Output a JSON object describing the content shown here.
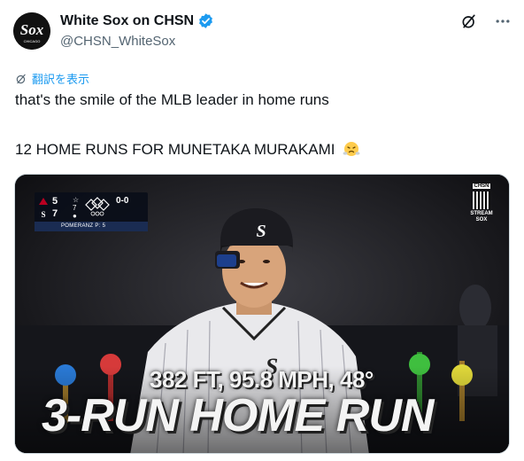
{
  "account": {
    "display_name": "White Sox on CHSN",
    "handle": "@CHSN_WhiteSox"
  },
  "icons": {
    "avatar": "white-sox-logo",
    "verified": "verified-badge-icon",
    "grok": "grok-icon",
    "more": "more-icon",
    "translate": "translate-icon",
    "emoji": "face-with-steam-emoji"
  },
  "translate_label": "翻訳を表示",
  "tweet": {
    "line1": "that's the smile of the MLB leader in home runs",
    "line2": "12 HOME RUNS FOR MUNETAKA MURAKAMI"
  },
  "video": {
    "scorebug": {
      "team1_score": "5",
      "team2_score": "7",
      "inning": "7",
      "count": "0-0",
      "pitcher": "POMERANZ  P: 5"
    },
    "network_tag": "CHSN",
    "network_label": "STREAM SOX",
    "stat_line": "382 FT, 95.8 MPH, 48°",
    "headline": "3-RUN HOME RUN"
  },
  "colors": {
    "accent": "#1d9bf0",
    "text_primary": "#0f1419",
    "text_secondary": "#536471"
  }
}
